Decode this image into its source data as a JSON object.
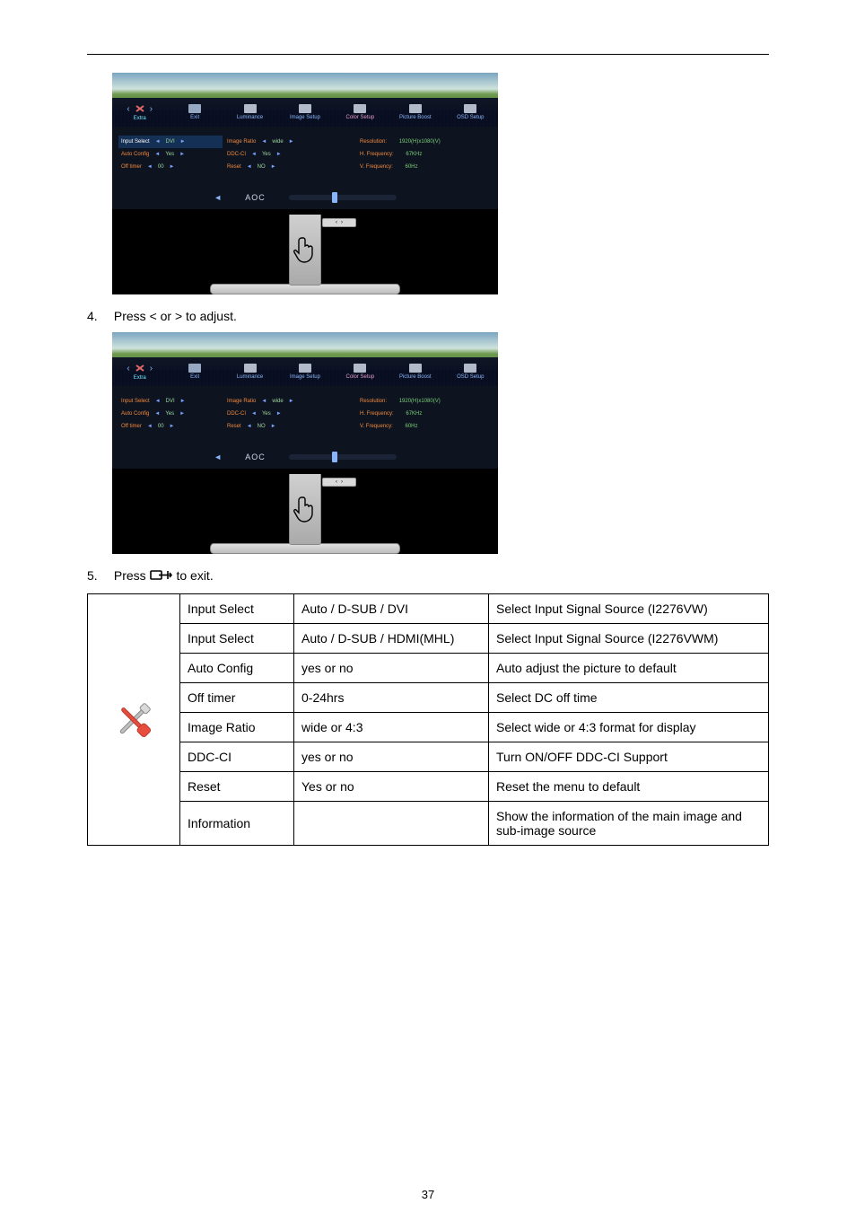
{
  "page_number": "37",
  "steps": {
    "s4": {
      "num": "4.",
      "text": "Press < or > to adjust."
    },
    "s5": {
      "num": "5.",
      "pre": "Press  ",
      "post": "  to exit."
    }
  },
  "osd_tabs": {
    "extra": "Extra",
    "exit": "Exit",
    "luminance": "Luminance",
    "image_setup": "Image Setup",
    "color_setup": "Color Setup",
    "picture_boost": "Picture Boost",
    "osd_setup": "OSD Setup"
  },
  "osd1": {
    "colA": {
      "hl": {
        "label": "Input Select",
        "value": "DVI"
      },
      "r2": {
        "label": "Auto Config",
        "value": "Yes"
      },
      "r3": {
        "label": "Off timer",
        "value": "00"
      }
    },
    "colB": {
      "r1": {
        "label": "Image Ratio",
        "value": "wide"
      },
      "r2": {
        "label": "DDC-CI",
        "value": "Yes"
      },
      "r3": {
        "label": "Reset",
        "value": "NO"
      }
    },
    "colC": {
      "r1": {
        "label": "Resolution:",
        "value": "1920(H)x1080(V)"
      },
      "r2": {
        "label": "H. Frequency:",
        "value": "67KHz"
      },
      "r3": {
        "label": "V. Frequency:",
        "value": "60Hz"
      }
    },
    "footer_logo": "AOC"
  },
  "osd2": {
    "colA": {
      "r1": {
        "label": "Input Select",
        "value": "DVI"
      },
      "r2": {
        "label": "Auto Config",
        "value": "Yes"
      },
      "r3": {
        "label": "Off timer",
        "value": "00"
      }
    },
    "colB": {
      "r1": {
        "label": "Image Ratio",
        "value": "wide"
      },
      "r2": {
        "label": "DDC-CI",
        "value": "Yes"
      },
      "r3": {
        "label": "Reset",
        "value": "NO"
      }
    },
    "colC": {
      "r1": {
        "label": "Resolution:",
        "value": "1920(H)x1080(V)"
      },
      "r2": {
        "label": "H. Frequency:",
        "value": "67KHz"
      },
      "r3": {
        "label": "V. Frequency:",
        "value": "60Hz"
      }
    },
    "footer_logo": "AOC"
  },
  "arrows": {
    "left": "◄",
    "right": "►"
  },
  "table": {
    "rows": [
      {
        "name": "Input Select",
        "range": "Auto / D-SUB / DVI",
        "desc": "Select Input Signal Source (I2276VW)"
      },
      {
        "name": "Input Select",
        "range": "Auto / D-SUB / HDMI(MHL)",
        "desc": "Select Input Signal Source (I2276VWM)"
      },
      {
        "name": "Auto Config",
        "range": "yes or no",
        "desc": "Auto adjust the picture to default"
      },
      {
        "name": "Off timer",
        "range": "0-24hrs",
        "desc": "Select DC off time"
      },
      {
        "name": "Image Ratio",
        "range": "wide or 4:3",
        "desc": "Select wide or 4:3 format for display"
      },
      {
        "name": "DDC-CI",
        "range": "yes or no",
        "desc": "Turn ON/OFF DDC-CI Support"
      },
      {
        "name": "Reset",
        "range": "Yes or no",
        "desc": "Reset the menu to default"
      },
      {
        "name": "Information",
        "range": "",
        "desc": "Show the information of the main image and sub-image source"
      }
    ]
  }
}
